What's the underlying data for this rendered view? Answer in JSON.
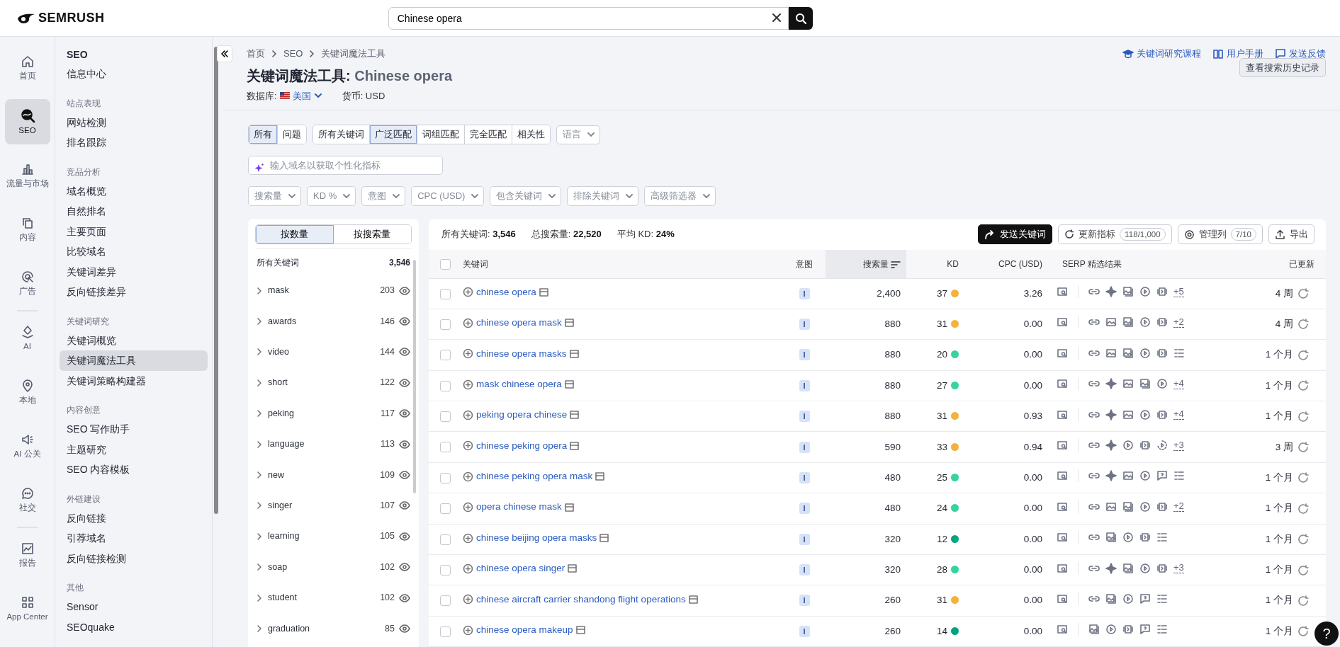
{
  "header": {
    "logo": "SEMRUSH",
    "search": {
      "value": "Chinese opera"
    }
  },
  "rail": [
    {
      "items": [
        {
          "label": "首页",
          "selected": false
        },
        {
          "label": "SEO",
          "selected": true
        },
        {
          "label": "流量与市场",
          "selected": false
        },
        {
          "label": "内容",
          "selected": false
        },
        {
          "label": "广告",
          "selected": false
        }
      ]
    },
    {
      "items": [
        {
          "label": "AI",
          "selected": false
        },
        {
          "label": "本地",
          "selected": false
        },
        {
          "label": "AI 公关",
          "selected": false
        },
        {
          "label": "社交",
          "selected": false
        }
      ]
    },
    {
      "items": [
        {
          "label": "报告",
          "selected": false
        },
        {
          "label": "App Center",
          "selected": false
        }
      ]
    }
  ],
  "sidebar": {
    "title": "SEO",
    "sections": [
      {
        "items": [
          {
            "label": "信息中心",
            "selected": false
          }
        ]
      },
      {
        "heading": "站点表现",
        "items": [
          {
            "label": "网站检测",
            "selected": false
          },
          {
            "label": "排名跟踪",
            "selected": false
          }
        ]
      },
      {
        "heading": "竞品分析",
        "items": [
          {
            "label": "域名概览",
            "selected": false
          },
          {
            "label": "自然排名",
            "selected": false
          },
          {
            "label": "主要页面",
            "selected": false
          },
          {
            "label": "比较域名",
            "selected": false
          },
          {
            "label": "关键词差异",
            "selected": false
          },
          {
            "label": "反向链接差异",
            "selected": false
          }
        ]
      },
      {
        "heading": "关键词研究",
        "items": [
          {
            "label": "关键词概览",
            "selected": false
          },
          {
            "label": "关键词魔法工具",
            "selected": true
          },
          {
            "label": "关键词策略构建器",
            "selected": false
          }
        ]
      },
      {
        "heading": "内容创意",
        "items": [
          {
            "label": "SEO 写作助手",
            "selected": false
          },
          {
            "label": "主题研究",
            "selected": false
          },
          {
            "label": "SEO 内容模板",
            "selected": false
          }
        ]
      },
      {
        "heading": "外链建设",
        "items": [
          {
            "label": "反向链接",
            "selected": false
          },
          {
            "label": "引荐域名",
            "selected": false
          },
          {
            "label": "反向链接检测",
            "selected": false
          }
        ]
      },
      {
        "heading": "其他",
        "items": [
          {
            "label": "Sensor",
            "selected": false
          },
          {
            "label": "SEOquake",
            "selected": false
          }
        ]
      }
    ]
  },
  "main": {
    "breadcrumb": [
      "首页",
      "SEO",
      "关键词魔法工具"
    ],
    "help_links": [
      "关键词研究课程",
      "用户手册",
      "发送反馈"
    ],
    "title": "关键词魔法工具:",
    "query": "Chinese opera",
    "database_label": "数据库:",
    "database": "美国",
    "currency": "货币: USD",
    "history_button": "查看搜索历史记录"
  },
  "filters": {
    "match_groups": [
      [
        {
          "label": "所有",
          "selected": true
        },
        {
          "label": "问题",
          "selected": false
        }
      ],
      [
        {
          "label": "所有关键词",
          "selected": false
        },
        {
          "label": "广泛匹配",
          "selected": true
        },
        {
          "label": "词组匹配",
          "selected": false
        },
        {
          "label": "完全匹配",
          "selected": false
        },
        {
          "label": "相关性",
          "selected": false
        }
      ]
    ],
    "language": "语言",
    "domain_placeholder": "输入域名以获取个性化指标",
    "dropdowns": [
      "搜索量",
      "KD %",
      "意图",
      "CPC (USD)",
      "包含关键词",
      "排除关键词",
      "高级筛选器"
    ]
  },
  "groups_panel": {
    "toggle": [
      {
        "label": "按数量",
        "selected": true
      },
      {
        "label": "按搜索量",
        "selected": false
      }
    ],
    "total_label": "所有关键词",
    "total": "3,546",
    "groups": [
      {
        "label": "mask",
        "count": "203"
      },
      {
        "label": "awards",
        "count": "146"
      },
      {
        "label": "video",
        "count": "144"
      },
      {
        "label": "short",
        "count": "122"
      },
      {
        "label": "peking",
        "count": "117"
      },
      {
        "label": "language",
        "count": "113"
      },
      {
        "label": "new",
        "count": "109"
      },
      {
        "label": "singer",
        "count": "107"
      },
      {
        "label": "learning",
        "count": "105"
      },
      {
        "label": "soap",
        "count": "102"
      },
      {
        "label": "student",
        "count": "102"
      },
      {
        "label": "graduation",
        "count": "85"
      }
    ]
  },
  "table": {
    "summary": [
      {
        "label": "所有关键词:",
        "value": "3,546"
      },
      {
        "label": "总搜索量:",
        "value": "22,520"
      },
      {
        "label": "平均 KD:",
        "value": "24%"
      }
    ],
    "send_button": "发送关键词",
    "update_button": {
      "label": "更新指标",
      "count": "118/1,000"
    },
    "columns_button": {
      "label": "管理列",
      "count": "7/10"
    },
    "export_button": "导出",
    "all_checked": false,
    "columns": [
      {
        "label": "关键词",
        "sorted": false
      },
      {
        "label": "意图",
        "sorted": false
      },
      {
        "label": "搜索量",
        "sorted": true
      },
      {
        "label": "KD",
        "sorted": false
      },
      {
        "label": "CPC (USD)",
        "sorted": false
      },
      {
        "label": "SERP 精选结果",
        "sorted": false
      },
      {
        "label": "已更新",
        "sorted": false
      }
    ],
    "rows": [
      {
        "checked": false,
        "keyword": "chinese opera",
        "intent": "I",
        "volume": "2,400",
        "kd": "37",
        "color": "#f5b13d",
        "cpc": "3.26",
        "serp": [
          {
            "kind": "link"
          },
          {
            "kind": "sparkle"
          },
          {
            "kind": "images"
          },
          {
            "kind": "video"
          },
          {
            "kind": "carousel"
          }
        ],
        "more": "+5",
        "updated": "4 周"
      },
      {
        "checked": false,
        "keyword": "chinese opera mask",
        "intent": "I",
        "volume": "880",
        "kd": "31",
        "color": "#f5b13d",
        "cpc": "0.00",
        "serp": [
          {
            "kind": "link"
          },
          {
            "kind": "image"
          },
          {
            "kind": "images"
          },
          {
            "kind": "video"
          },
          {
            "kind": "carousel"
          }
        ],
        "more": "+2",
        "updated": "4 周"
      },
      {
        "checked": false,
        "keyword": "chinese opera masks",
        "intent": "I",
        "volume": "880",
        "kd": "20",
        "color": "#36d39e",
        "cpc": "0.00",
        "serp": [
          {
            "kind": "link"
          },
          {
            "kind": "image"
          },
          {
            "kind": "images"
          },
          {
            "kind": "video"
          },
          {
            "kind": "carousel"
          },
          {
            "kind": "list"
          }
        ],
        "updated": "1 个月"
      },
      {
        "checked": false,
        "keyword": "mask chinese opera",
        "intent": "I",
        "volume": "880",
        "kd": "27",
        "color": "#36d39e",
        "cpc": "0.00",
        "serp": [
          {
            "kind": "link"
          },
          {
            "kind": "sparkle"
          },
          {
            "kind": "image"
          },
          {
            "kind": "images"
          },
          {
            "kind": "video"
          }
        ],
        "more": "+4",
        "updated": "1 个月"
      },
      {
        "checked": false,
        "keyword": "peking opera chinese",
        "intent": "I",
        "volume": "880",
        "kd": "31",
        "color": "#f5b13d",
        "cpc": "0.93",
        "serp": [
          {
            "kind": "link"
          },
          {
            "kind": "sparkle"
          },
          {
            "kind": "image"
          },
          {
            "kind": "video"
          },
          {
            "kind": "carousel"
          }
        ],
        "more": "+4",
        "updated": "1 个月"
      },
      {
        "checked": false,
        "keyword": "chinese peking opera",
        "intent": "I",
        "volume": "590",
        "kd": "33",
        "color": "#f5b13d",
        "cpc": "0.94",
        "serp": [
          {
            "kind": "link"
          },
          {
            "kind": "sparkle"
          },
          {
            "kind": "video"
          },
          {
            "kind": "carousel"
          },
          {
            "kind": "timer"
          }
        ],
        "more": "+3",
        "updated": "3 周"
      },
      {
        "checked": false,
        "keyword": "chinese peking opera mask",
        "intent": "I",
        "volume": "480",
        "kd": "25",
        "color": "#36d39e",
        "cpc": "0.00",
        "serp": [
          {
            "kind": "link"
          },
          {
            "kind": "sparkle"
          },
          {
            "kind": "image"
          },
          {
            "kind": "video"
          },
          {
            "kind": "faq"
          },
          {
            "kind": "list"
          }
        ],
        "updated": "1 个月"
      },
      {
        "checked": false,
        "keyword": "opera chinese mask",
        "intent": "I",
        "volume": "480",
        "kd": "24",
        "color": "#36d39e",
        "cpc": "0.00",
        "serp": [
          {
            "kind": "link"
          },
          {
            "kind": "image"
          },
          {
            "kind": "images"
          },
          {
            "kind": "video"
          },
          {
            "kind": "carousel"
          }
        ],
        "more": "+2",
        "updated": "1 个月"
      },
      {
        "checked": false,
        "keyword": "chinese beijing opera masks",
        "intent": "I",
        "volume": "320",
        "kd": "12",
        "color": "#00a382",
        "cpc": "0.00",
        "serp": [
          {
            "kind": "link"
          },
          {
            "kind": "images"
          },
          {
            "kind": "video"
          },
          {
            "kind": "carousel"
          },
          {
            "kind": "list"
          }
        ],
        "updated": "1 个月"
      },
      {
        "checked": false,
        "keyword": "chinese opera singer",
        "intent": "I",
        "volume": "320",
        "kd": "28",
        "color": "#36d39e",
        "cpc": "0.00",
        "serp": [
          {
            "kind": "link"
          },
          {
            "kind": "sparkle"
          },
          {
            "kind": "images"
          },
          {
            "kind": "video"
          },
          {
            "kind": "carousel"
          }
        ],
        "more": "+3",
        "updated": "1 个月"
      },
      {
        "checked": false,
        "keyword": "chinese aircraft carrier shandong flight operations",
        "intent": "I",
        "volume": "260",
        "kd": "31",
        "color": "#f5b13d",
        "cpc": "0.00",
        "serp": [
          {
            "kind": "link"
          },
          {
            "kind": "images"
          },
          {
            "kind": "video"
          },
          {
            "kind": "faq"
          },
          {
            "kind": "list"
          }
        ],
        "updated": "1 个月"
      },
      {
        "checked": false,
        "keyword": "chinese opera makeup",
        "intent": "I",
        "volume": "260",
        "kd": "14",
        "color": "#00a382",
        "cpc": "0.00",
        "serp": [
          {
            "kind": "images"
          },
          {
            "kind": "video"
          },
          {
            "kind": "carousel"
          },
          {
            "kind": "faq"
          },
          {
            "kind": "list"
          }
        ],
        "updated": "1 个月"
      }
    ]
  },
  "help_button": "?"
}
